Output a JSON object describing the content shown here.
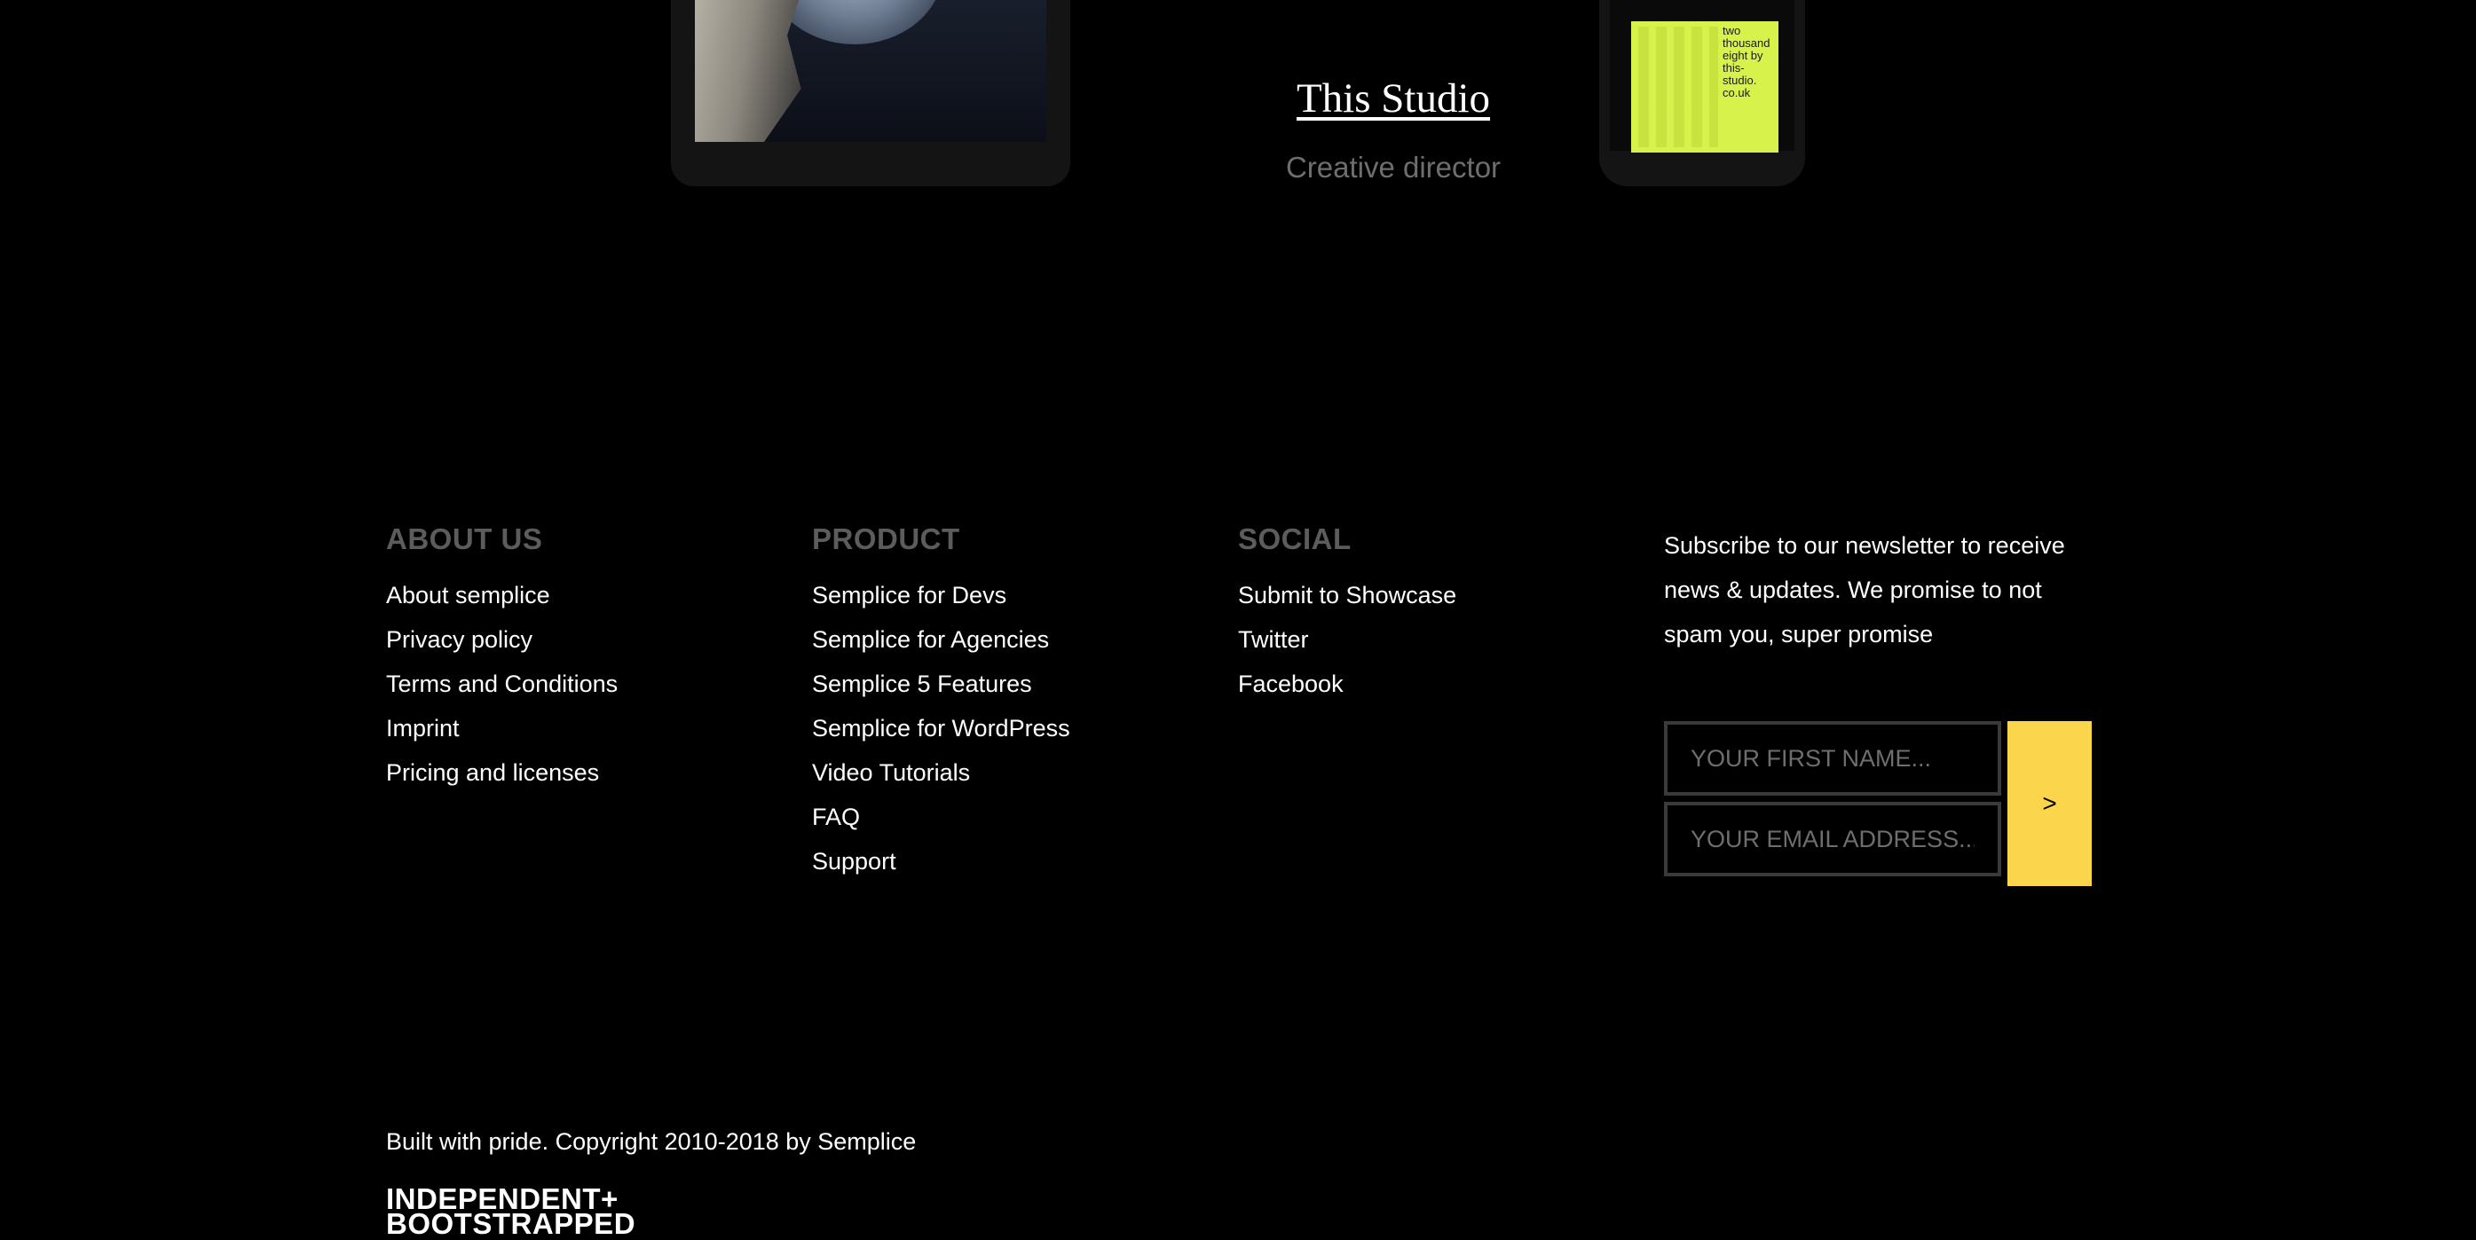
{
  "showcase": {
    "studio_name": "This Studio",
    "studio_role": "Creative director",
    "poster_text": "two thousand eight by this-studio. co.uk"
  },
  "footer": {
    "about": {
      "title": "ABOUT US",
      "links": [
        "About semplice",
        "Privacy policy",
        "Terms and Conditions",
        "Imprint",
        "Pricing and licenses"
      ]
    },
    "product": {
      "title": "PRODUCT",
      "links": [
        "Semplice for Devs",
        "Semplice for Agencies",
        "Semplice 5 Features",
        "Semplice for WordPress",
        "Video Tutorials",
        "FAQ",
        "Support"
      ]
    },
    "social": {
      "title": "SOCIAL",
      "links": [
        "Submit to Showcase",
        "Twitter",
        "Facebook"
      ]
    },
    "newsletter": {
      "text": "Subscribe to our newsletter to receive news & updates. We promise to not spam you, super promise",
      "first_name_placeholder": "YOUR FIRST NAME...",
      "email_placeholder": "YOUR EMAIL ADDRESS...",
      "first_name_value": "",
      "email_value": "",
      "submit_label": ">",
      "accent_color": "#fbd54b"
    }
  },
  "bottom": {
    "copyright": "Built with pride. Copyright 2010-2018 by Semplice",
    "badge_line1": "INDEPENDENT+",
    "badge_line2": "BOOTSTRAPPED"
  }
}
